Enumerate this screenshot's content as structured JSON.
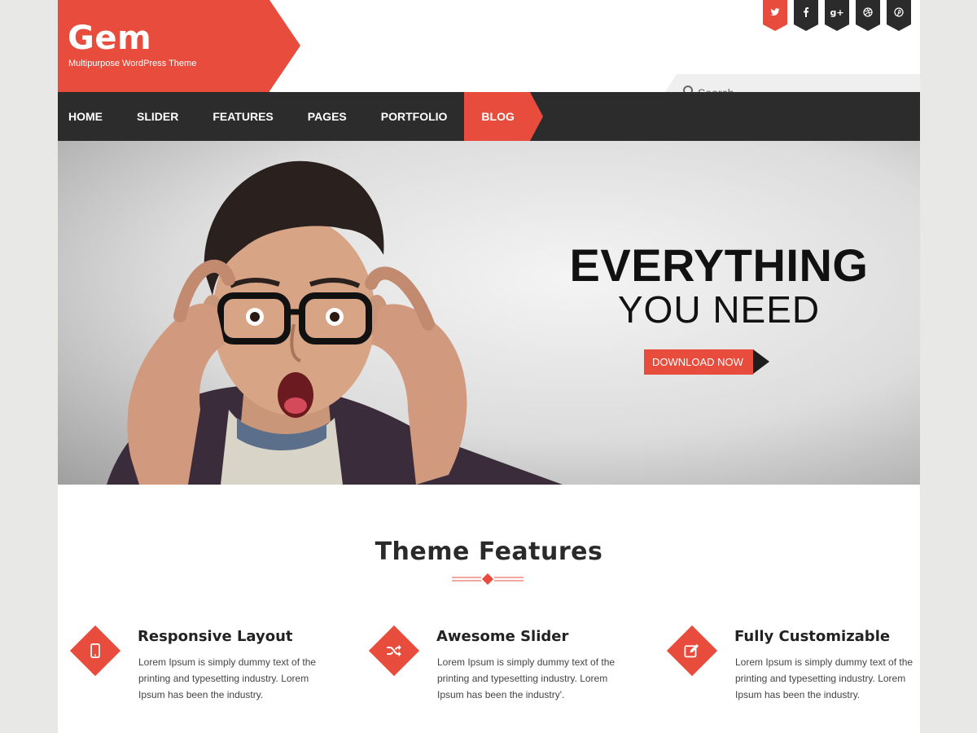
{
  "brand": {
    "name": "Gem",
    "tagline": "Multipurpose WordPress Theme",
    "accent": "#e74c3c",
    "dark": "#2c2c2c"
  },
  "social": [
    {
      "icon": "twitter-icon",
      "glyph": "t"
    },
    {
      "icon": "facebook-icon",
      "glyph": "f"
    },
    {
      "icon": "google-plus-icon",
      "glyph": "g+"
    },
    {
      "icon": "dribbble-icon",
      "glyph": "⊕"
    },
    {
      "icon": "pinterest-icon",
      "glyph": "℗"
    }
  ],
  "search": {
    "placeholder": "Search"
  },
  "nav": [
    {
      "label": "HOME",
      "active": false
    },
    {
      "label": "SLIDER",
      "active": false
    },
    {
      "label": "FEATURES",
      "active": false
    },
    {
      "label": "PAGES",
      "active": false
    },
    {
      "label": "PORTFOLIO",
      "active": false
    },
    {
      "label": "BLOG",
      "active": true
    }
  ],
  "hero": {
    "headline": "EVERYTHING",
    "subheadline": "YOU NEED",
    "button": "DOWNLOAD NOW"
  },
  "features": {
    "title": "Theme Features",
    "items": [
      {
        "icon": "mobile-icon",
        "title": "Responsive Layout",
        "text": "Lorem Ipsum is simply dummy text of the printing and typesetting industry. Lorem Ipsum has been the industry."
      },
      {
        "icon": "shuffle-icon",
        "title": "Awesome Slider",
        "text": "Lorem Ipsum is simply dummy text of the printing and typesetting industry. Lorem Ipsum has been the industry'."
      },
      {
        "icon": "edit-icon",
        "title": "Fully Customizable",
        "text": "Lorem Ipsum is simply dummy text of the printing and typesetting industry. Lorem Ipsum has been the industry."
      }
    ]
  }
}
